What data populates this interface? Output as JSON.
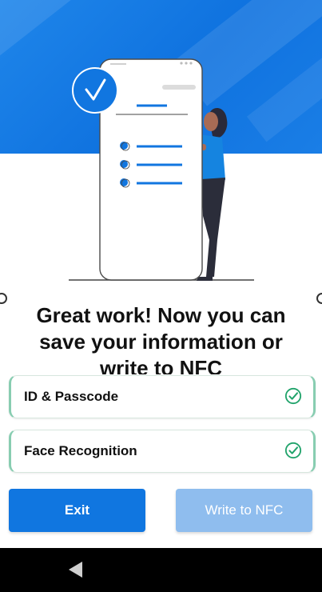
{
  "headline": "Great work! Now you can save your information or write to NFC",
  "cards": [
    {
      "label": "ID & Passcode",
      "icon": "check-circle-icon"
    },
    {
      "label": "Face Recognition",
      "icon": "check-circle-icon"
    }
  ],
  "buttons": {
    "exit": "Exit",
    "write_nfc": "Write to NFC"
  },
  "colors": {
    "primary": "#1076e0",
    "primary_disabled": "#8fbdee",
    "success": "#21a36b",
    "hero": "#1282e6"
  }
}
